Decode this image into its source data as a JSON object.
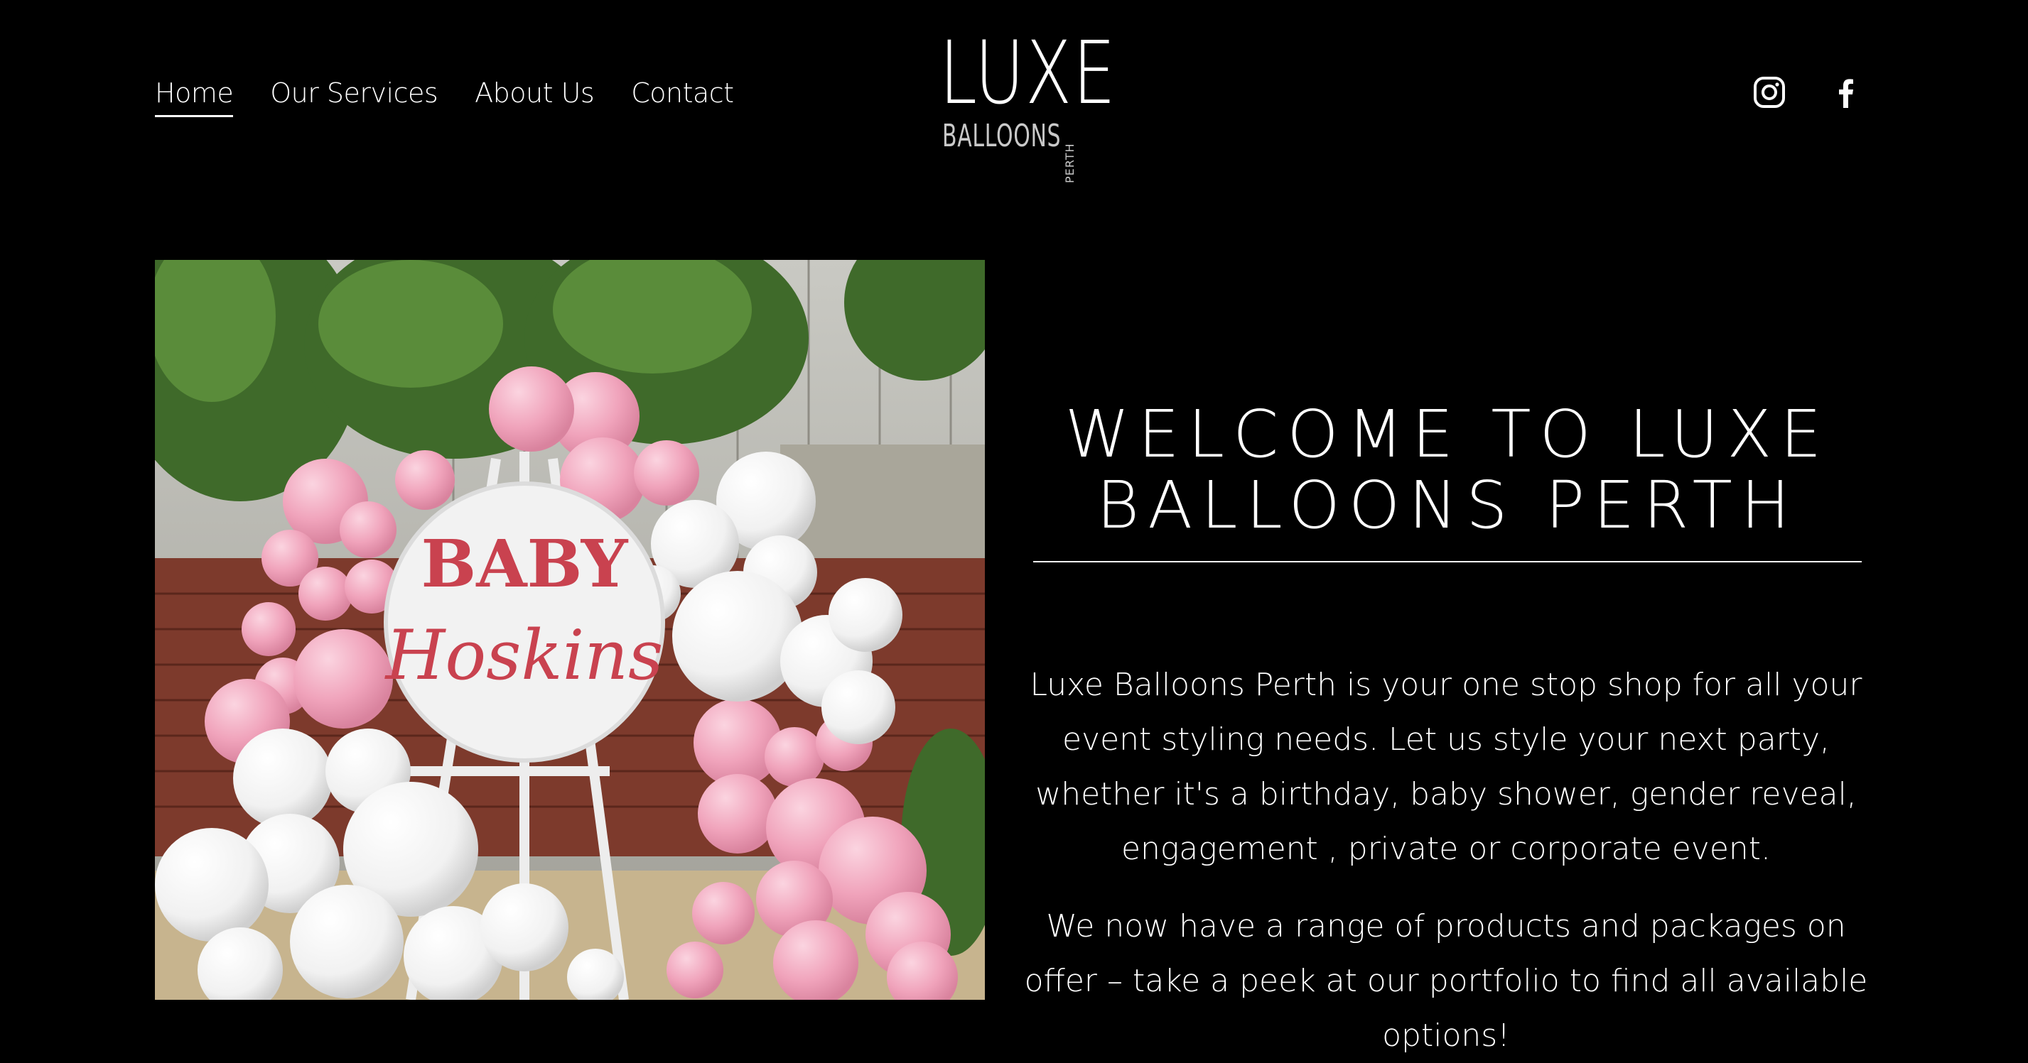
{
  "header": {
    "nav": [
      {
        "label": "Home",
        "active": true
      },
      {
        "label": "Our Services",
        "active": false
      },
      {
        "label": "About Us",
        "active": false
      },
      {
        "label": "Contact",
        "active": false
      }
    ],
    "logo": {
      "main": "LUXE",
      "sub": "BALLOONS",
      "tag": "PERTH"
    },
    "social": [
      {
        "icon": "instagram-icon"
      },
      {
        "icon": "facebook-icon"
      }
    ]
  },
  "hero_image": {
    "sign_line1": "BABY",
    "sign_line2": "Hoskins"
  },
  "content": {
    "title": "WELCOME TO LUXE BALLOONS PERTH",
    "paragraph1": "Luxe Balloons Perth is your one stop shop for all your event styling needs. Let us style your next party, whether it's a birthday, baby shower, gender reveal, engagement , private or corporate event.",
    "paragraph2": "We now have a range of products and packages on offer – take a peek at our portfolio to find all available options!"
  },
  "colors": {
    "background": "#000000",
    "text": "#ffffff",
    "balloon_pink": "#f1a5bd",
    "balloon_white": "#f4f4f4",
    "sign_text": "#c9424f"
  }
}
